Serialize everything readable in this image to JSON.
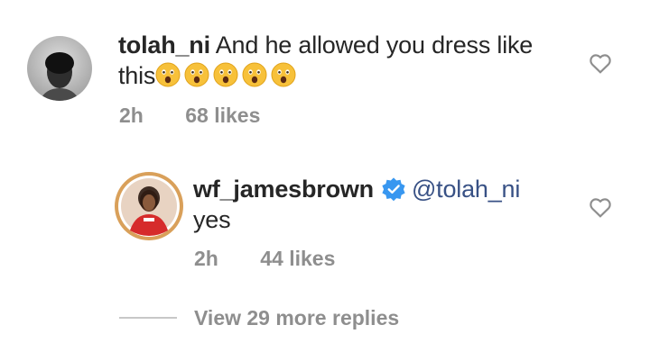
{
  "comment1": {
    "username": "tolah_ni",
    "text_line1": "And he allowed you dress like",
    "text_line2": "this",
    "emoji": [
      "astonished-face",
      "astonished-face",
      "astonished-face",
      "astonished-face",
      "astonished-face"
    ],
    "time": "2h",
    "likes": "68 likes"
  },
  "comment2": {
    "username": "wf_jamesbrown",
    "mention": "@tolah_ni",
    "text": "yes",
    "time": "2h",
    "likes": "44 likes",
    "verified_color": "#3897f0"
  },
  "replies_label": "View 29 more replies",
  "colors": {
    "text": "#262626",
    "muted": "#8e8e8e",
    "mention": "#385185",
    "story_ring": "#d6a05a"
  },
  "icons": {
    "like": "heart-outline-icon",
    "verified": "verified-badge-icon"
  }
}
